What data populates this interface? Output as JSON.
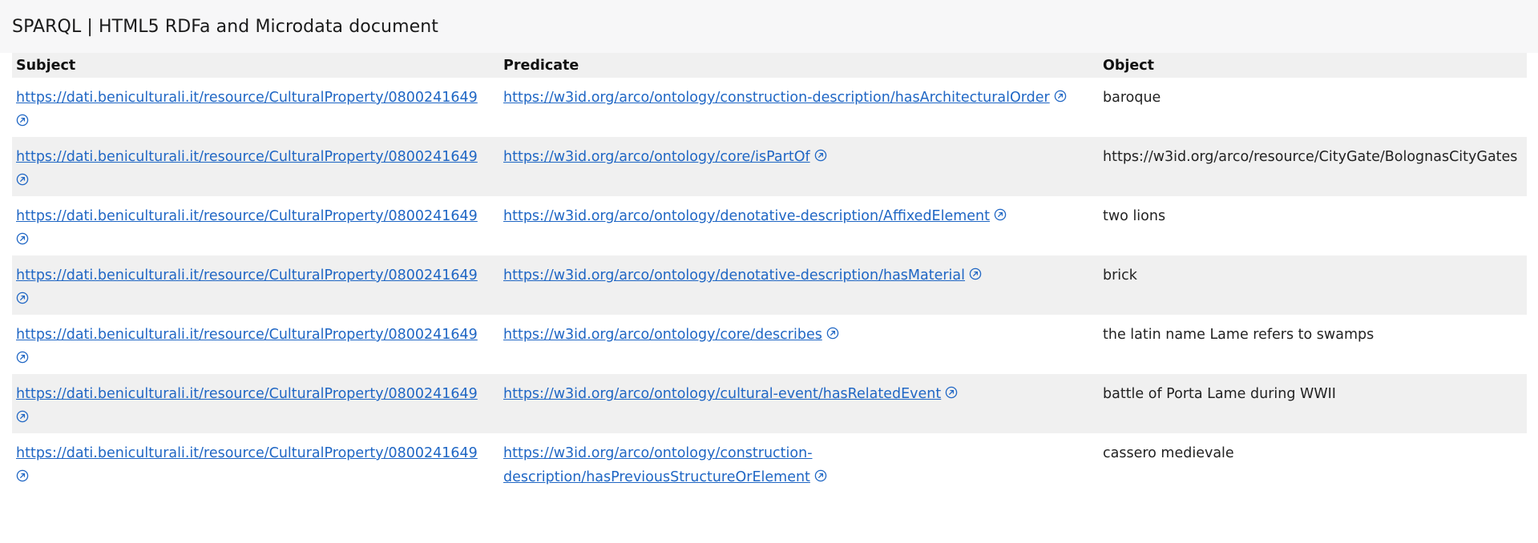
{
  "page": {
    "title": "SPARQL | HTML5 RDFa and Microdata document"
  },
  "table": {
    "headers": {
      "subject": "Subject",
      "predicate": "Predicate",
      "object": "Object"
    },
    "rows": [
      {
        "subject": "https://dati.beniculturali.it/resource/CulturalProperty/0800241649",
        "predicate": "https://w3id.org/arco/ontology/construction-description/hasArchitecturalOrder",
        "object": "baroque"
      },
      {
        "subject": "https://dati.beniculturali.it/resource/CulturalProperty/0800241649",
        "predicate": "https://w3id.org/arco/ontology/core/isPartOf",
        "object": "https://w3id.org/arco/resource/CityGate/BolognasCityGates"
      },
      {
        "subject": "https://dati.beniculturali.it/resource/CulturalProperty/0800241649",
        "predicate": "https://w3id.org/arco/ontology/denotative-description/AffixedElement",
        "object": "two lions"
      },
      {
        "subject": "https://dati.beniculturali.it/resource/CulturalProperty/0800241649",
        "predicate": "https://w3id.org/arco/ontology/denotative-description/hasMaterial",
        "object": "brick"
      },
      {
        "subject": "https://dati.beniculturali.it/resource/CulturalProperty/0800241649",
        "predicate": "https://w3id.org/arco/ontology/core/describes",
        "object": "the latin name Lame refers to swamps"
      },
      {
        "subject": "https://dati.beniculturali.it/resource/CulturalProperty/0800241649",
        "predicate": "https://w3id.org/arco/ontology/cultural-event/hasRelatedEvent",
        "object": "battle of Porta Lame during WWII"
      },
      {
        "subject": "https://dati.beniculturali.it/resource/CulturalProperty/0800241649",
        "predicate": "https://w3id.org/arco/ontology/construction-description/hasPreviousStructureOrElement",
        "object": "cassero medievale"
      }
    ]
  },
  "icons": {
    "external_link": "external-link-icon"
  },
  "colors": {
    "link": "#1f66c4",
    "header_bg": "#f7f7f8",
    "stripe_bg": "#f0f0f0"
  }
}
